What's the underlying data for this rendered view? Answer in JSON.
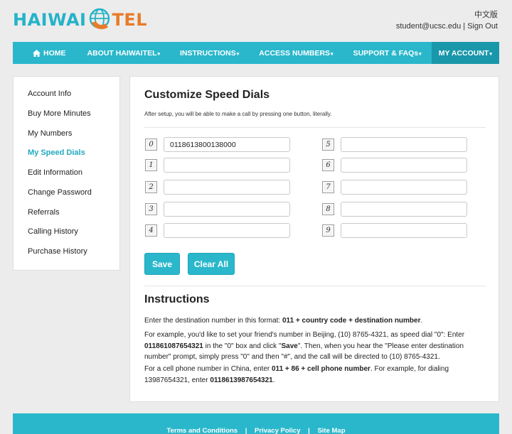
{
  "brand": {
    "part1": "HAIWAI",
    "part2": "TEL"
  },
  "header": {
    "lang": "中文版",
    "user": "student@ucsc.edu",
    "sep": "|",
    "signout": "Sign Out"
  },
  "nav": {
    "home": "HOME",
    "about": "ABOUT HAIWAITEL",
    "instructions": "INSTRUCTIONS",
    "access": "ACCESS NUMBERS",
    "support": "SUPPORT & FAQs",
    "account": "MY ACCOUNT",
    "caret": "▾"
  },
  "sidebar": {
    "items": [
      "Account Info",
      "Buy More Minutes",
      "My Numbers",
      "My Speed Dials",
      "Edit Information",
      "Change Password",
      "Referrals",
      "Calling History",
      "Purchase History"
    ],
    "active_index": 3
  },
  "main": {
    "title": "Customize Speed Dials",
    "subtitle": "After setup, you will be able to make a call by pressing one button, literally.",
    "dials": [
      {
        "key": "0",
        "value": "0118613800138000"
      },
      {
        "key": "1",
        "value": ""
      },
      {
        "key": "2",
        "value": ""
      },
      {
        "key": "3",
        "value": ""
      },
      {
        "key": "4",
        "value": ""
      },
      {
        "key": "5",
        "value": ""
      },
      {
        "key": "6",
        "value": ""
      },
      {
        "key": "7",
        "value": ""
      },
      {
        "key": "8",
        "value": ""
      },
      {
        "key": "9",
        "value": ""
      }
    ],
    "save_label": "Save",
    "clear_label": "Clear All"
  },
  "instructions": {
    "heading": "Instructions",
    "p1_pre": "Enter the destination number in this format: ",
    "p1_bold": "011 + country code + destination number",
    "p1_post": ".",
    "p2_a": "For example, you'd like to set your friend's number in Beijing, (10) 8765-4321, as speed dial \"0\": Enter ",
    "p2_b": "011861087654321",
    "p2_c": " in the \"0\" box and click \"",
    "p2_d": "Save",
    "p2_e": "\". Then, when you hear the \"Please enter destination number\" prompt, simply press \"0\" and then \"#\", and the call will be directed to (10) 8765-4321.",
    "p3_a": "For a cell phone number in China, enter ",
    "p3_b": "011 + 86 + cell phone number",
    "p3_c": ". For example, for dialing 13987654321, enter ",
    "p3_d": "0118613987654321",
    "p3_e": "."
  },
  "footer": {
    "terms": "Terms and Conditions",
    "sep": "|",
    "privacy": "Privacy Policy",
    "sitemap": "Site Map"
  },
  "colors": {
    "accent": "#2ab7cb",
    "accent_dark": "#1a97aa",
    "brand_orange": "#e87b2a"
  },
  "icons": {
    "logo": "phone-globe-icon",
    "home": "home-icon"
  }
}
